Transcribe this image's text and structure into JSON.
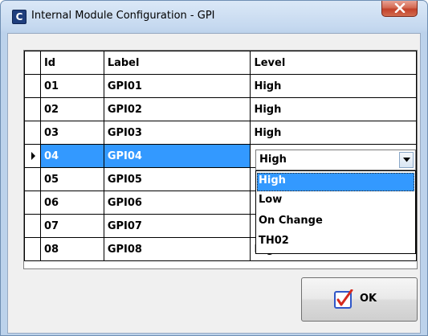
{
  "window": {
    "title": "Internal Module Configuration - GPI",
    "app_icon_letter": "C"
  },
  "grid": {
    "columns": [
      "Id",
      "Label",
      "Level"
    ],
    "rows": [
      {
        "id": "01",
        "label": "GPI01",
        "level": "High"
      },
      {
        "id": "02",
        "label": "GPI02",
        "level": "High"
      },
      {
        "id": "03",
        "label": "GPI03",
        "level": "High"
      },
      {
        "id": "04",
        "label": "GPI04",
        "level": "High"
      },
      {
        "id": "05",
        "label": "GPI05",
        "level": ""
      },
      {
        "id": "06",
        "label": "GPI06",
        "level": ""
      },
      {
        "id": "07",
        "label": "GPI07",
        "level": ""
      },
      {
        "id": "08",
        "label": "GPI08",
        "level": "High"
      }
    ],
    "selected_row_index": 3
  },
  "level_editor": {
    "value": "High",
    "options": [
      "High",
      "Low",
      "On Change",
      "TH02"
    ],
    "highlighted_option": "High"
  },
  "buttons": {
    "ok_label": "OK"
  },
  "colors": {
    "selection": "#3399ff",
    "ok_check": "#d42a1e",
    "ok_box": "#2f56c8"
  }
}
